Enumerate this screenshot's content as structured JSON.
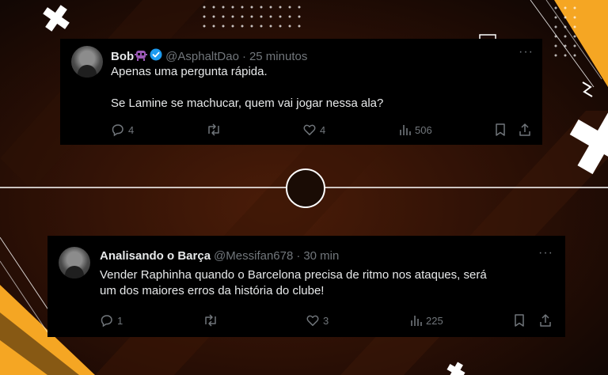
{
  "tweets": [
    {
      "name": "Bob",
      "handle": "@AsphaltDao",
      "separator": "·",
      "time": "25 minutos",
      "more_icon": "more-dots-icon",
      "lines": [
        "Apenas uma pergunta rápida.",
        "",
        "Se Lamine se machucar, quem vai jogar nessa ala?"
      ],
      "replies": "4",
      "retweets": "",
      "likes": "4",
      "views": "506"
    },
    {
      "name": "Analisando o Barça",
      "handle": "@Messifan678",
      "separator": "·",
      "time": "30 min",
      "more_icon": "more-dots-icon",
      "lines": [
        "Vender Raphinha quando o Barcelona precisa de ritmo nos ataques, será",
        "um dos maiores erros da história do clube!"
      ],
      "replies": "1",
      "retweets": "",
      "likes": "3",
      "views": "225"
    }
  ],
  "colors": {
    "background": "#1a0c05",
    "accent_yellow": "#f5a623",
    "text": "#e7e9ea",
    "muted": "#71767b",
    "verified_blue": "#1d9bf0"
  }
}
